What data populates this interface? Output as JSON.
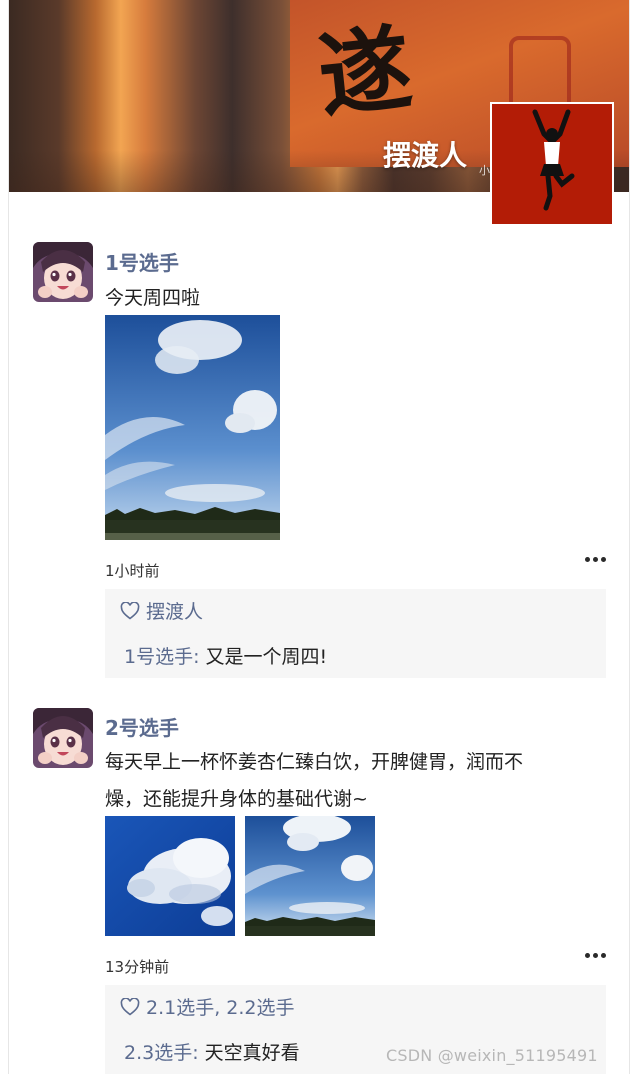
{
  "header": {
    "cover_title": "摆渡人",
    "cover_glyph": "遂",
    "cover_subtitle": "小"
  },
  "posts": [
    {
      "username": "1号选手",
      "content": "今天周四啦",
      "time": "1小时前",
      "likes": "摆渡人",
      "comments": [
        {
          "author": "1号选手:",
          "text": "又是一个周四!"
        }
      ]
    },
    {
      "username": "2号选手",
      "content_line1": "每天早上一杯怀姜杏仁臻白饮，开脾健胃，润而不",
      "content_line2": "燥，还能提升身体的基础代谢~",
      "time": "13分钟前",
      "likes": "2.1选手, 2.2选手",
      "comments": [
        {
          "author": "2.3选手:",
          "text": "天空真好看"
        }
      ]
    }
  ],
  "watermark": "CSDN @weixin_51195491",
  "icons": {
    "heart": "heart-icon",
    "more": "more-dots-icon"
  },
  "colors": {
    "username": "#5b6b8f",
    "interaction_bg": "#f6f6f6",
    "profile_avatar_bg": "#b31c06"
  }
}
